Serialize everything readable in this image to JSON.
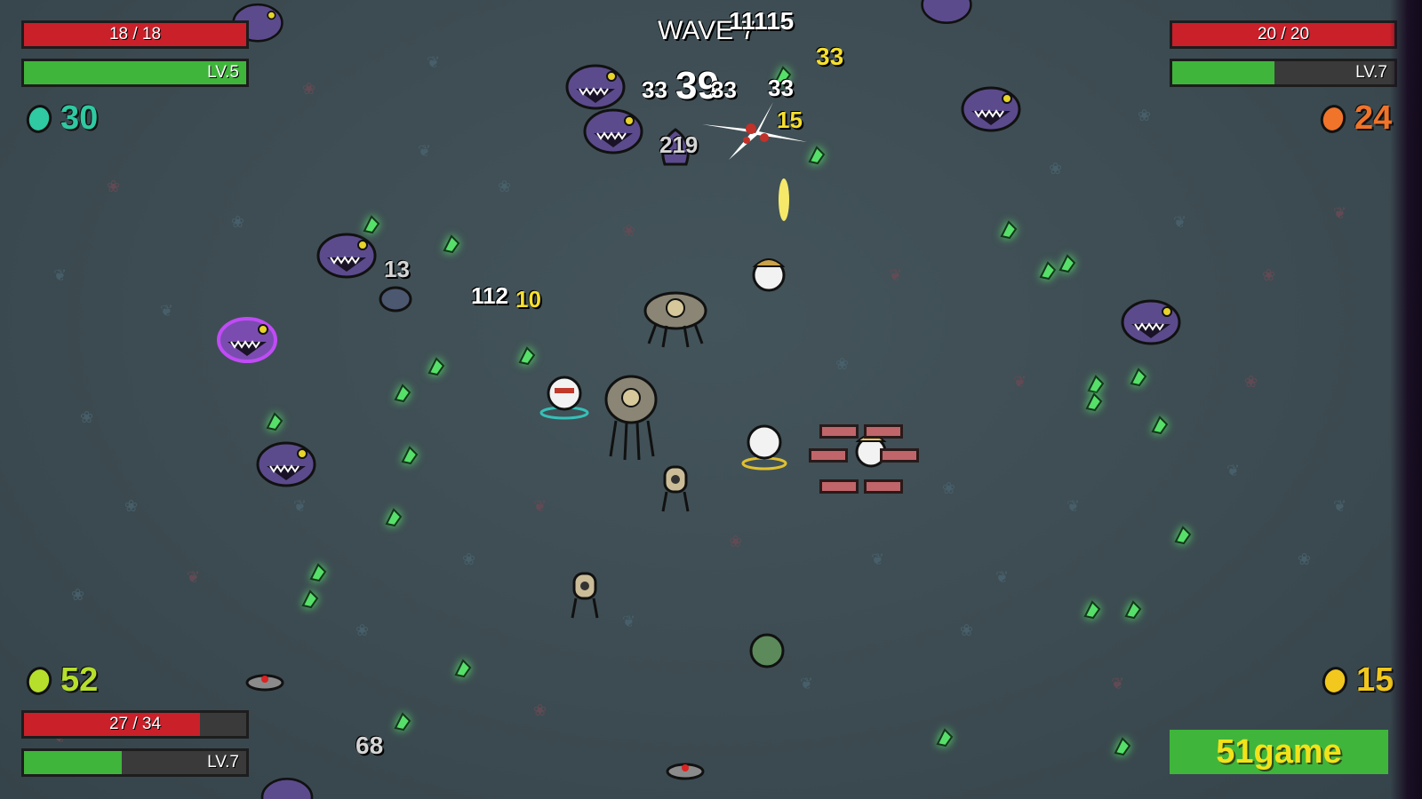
{
  "hud": {
    "wave_label": "WAVE 7",
    "players": [
      {
        "hp_text": "18 / 18",
        "hp_fraction": 1.0,
        "level_text": "LV.5",
        "xp_fraction": 1.0,
        "materials": "30",
        "material_color": "#2fc9a2"
      },
      {
        "hp_text": "20 / 20",
        "hp_fraction": 1.0,
        "level_text": "LV.7",
        "xp_fraction": 0.46,
        "materials": "24",
        "material_color": "#f0742a"
      },
      {
        "hp_text": "27 / 34",
        "hp_fraction": 0.79,
        "level_text": "LV.7",
        "xp_fraction": 0.44,
        "materials": "52",
        "material_color": "#b6df2c"
      },
      {
        "materials": "15",
        "material_color": "#f2c81e"
      }
    ]
  },
  "damage_numbers": [
    {
      "text": "11115",
      "style": "w"
    },
    {
      "text": "33",
      "style": "y"
    },
    {
      "text": "33",
      "style": "w"
    },
    {
      "text": "39",
      "style": "w"
    },
    {
      "text": "33",
      "style": "w"
    },
    {
      "text": "33",
      "style": "w"
    },
    {
      "text": "15",
      "style": "y"
    },
    {
      "text": "219",
      "style": "g"
    },
    {
      "text": "13",
      "style": "g"
    },
    {
      "text": "112",
      "style": "w"
    },
    {
      "text": "10",
      "style": "y"
    },
    {
      "text": "68",
      "style": "g"
    }
  ],
  "watermark": "51game",
  "colors": {
    "hp": "#c9202a",
    "xp": "#3fb53b",
    "enemy": "#5a4a8a",
    "material": "#56e06a"
  }
}
